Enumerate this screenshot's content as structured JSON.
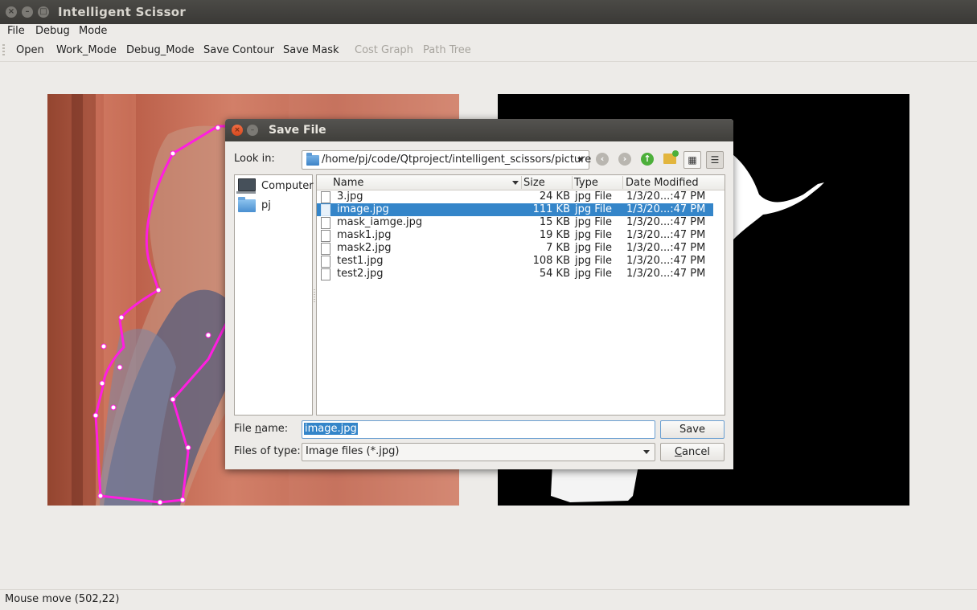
{
  "window": {
    "title": "Intelligent Scissor"
  },
  "menu": [
    "File",
    "Debug",
    "Mode"
  ],
  "toolbar": {
    "items": [
      {
        "label": "Open",
        "enabled": true
      },
      {
        "label": "Work_Mode",
        "enabled": true
      },
      {
        "label": "Debug_Mode",
        "enabled": true
      },
      {
        "label": "Save Contour",
        "enabled": true
      },
      {
        "label": "Save Mask",
        "enabled": true
      },
      {
        "label": "Cost Graph",
        "enabled": false
      },
      {
        "label": "Path Tree",
        "enabled": false
      }
    ]
  },
  "status": {
    "text": "Mouse move (502,22)"
  },
  "dialog": {
    "title": "Save File",
    "look_in_label": "Look in:",
    "look_in_path": "/home/pj/code/Qtproject/intelligent_scissors/picture",
    "sidebar": [
      {
        "label": "Computer",
        "icon": "computer-icon"
      },
      {
        "label": "pj",
        "icon": "folder-icon"
      }
    ],
    "columns": [
      "Name",
      "Size",
      "Type",
      "Date Modified"
    ],
    "files": [
      {
        "name": "3.jpg",
        "size": "24 KB",
        "type": "jpg File",
        "date": "1/3/20...:47 PM",
        "selected": false
      },
      {
        "name": "image.jpg",
        "size": "111 KB",
        "type": "jpg File",
        "date": "1/3/20...:47 PM",
        "selected": true
      },
      {
        "name": "mask_iamge.jpg",
        "size": "15 KB",
        "type": "jpg File",
        "date": "1/3/20...:47 PM",
        "selected": false
      },
      {
        "name": "mask1.jpg",
        "size": "19 KB",
        "type": "jpg File",
        "date": "1/3/20...:47 PM",
        "selected": false
      },
      {
        "name": "mask2.jpg",
        "size": "7 KB",
        "type": "jpg File",
        "date": "1/3/20...:47 PM",
        "selected": false
      },
      {
        "name": "test1.jpg",
        "size": "108 KB",
        "type": "jpg File",
        "date": "1/3/20...:47 PM",
        "selected": false
      },
      {
        "name": "test2.jpg",
        "size": "54 KB",
        "type": "jpg File",
        "date": "1/3/20...:47 PM",
        "selected": false
      }
    ],
    "file_name_label": "File name:",
    "file_name_value": "image.jpg",
    "file_type_label": "Files of type:",
    "file_type_value": "Image files (*.jpg)",
    "save_label": "Save",
    "cancel_label": "Cancel"
  },
  "colors": {
    "selection": "#3485c9",
    "contour": "#ff1ee0"
  }
}
